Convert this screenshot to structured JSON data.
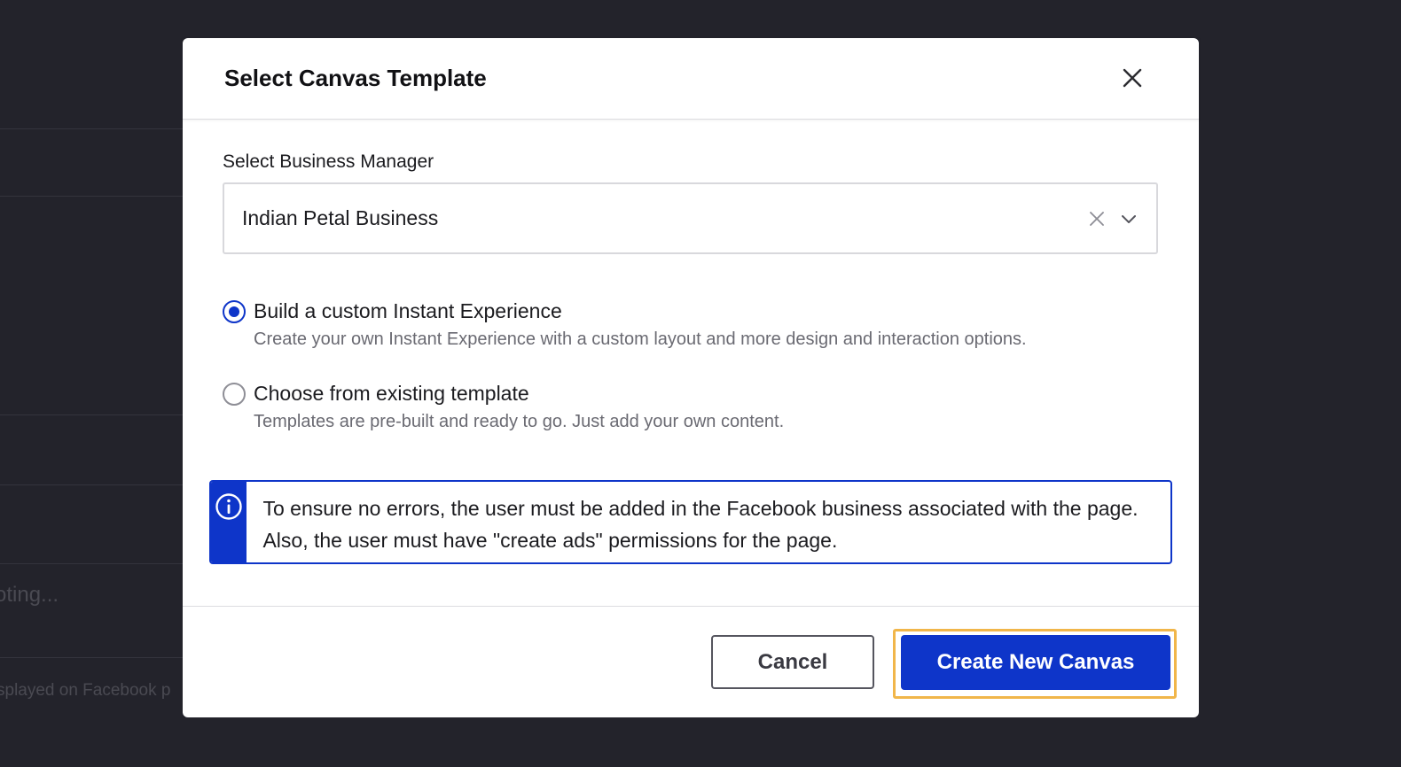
{
  "background": {
    "partial_text_1": "oting...",
    "partial_text_2": "splayed on Facebook p"
  },
  "modal": {
    "title": "Select Canvas Template",
    "close_icon": "close-icon",
    "business_manager": {
      "label": "Select Business Manager",
      "selected_value": "Indian Petal Business"
    },
    "options": [
      {
        "label": "Build a custom Instant Experience",
        "description": "Create your own Instant Experience with a custom layout and more design and interaction options.",
        "selected": true
      },
      {
        "label": "Choose from existing template",
        "description": "Templates are pre-built and ready to go. Just add your own content.",
        "selected": false
      }
    ],
    "info_message": "To ensure no errors, the user must be added in the Facebook business associated with the page. Also, the user must have \"create ads\" permissions for the page.",
    "footer": {
      "cancel_label": "Cancel",
      "create_label": "Create New Canvas"
    }
  },
  "colors": {
    "accent": "#0e35c9",
    "focus_ring": "#f1b64a",
    "backdrop": "#23232b"
  }
}
